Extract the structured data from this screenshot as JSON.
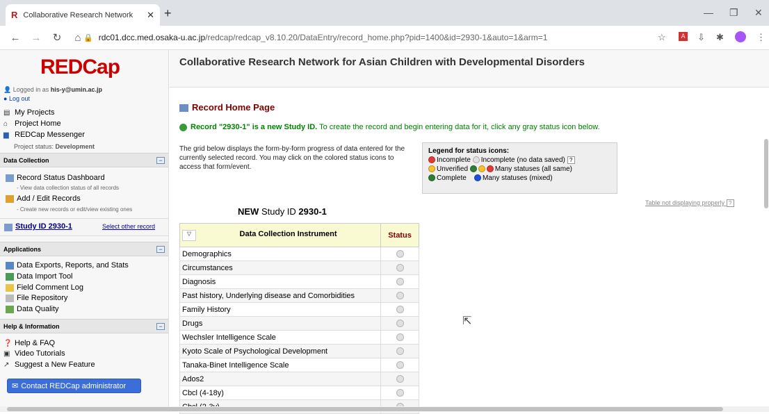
{
  "browser": {
    "tab_title": "Collaborative Research Network",
    "tab_close": "✕",
    "new_tab": "+",
    "url_host": "rdc01.dcc.med.osaka-u.ac.jp",
    "url_path": "/redcap/redcap_v8.10.20/DataEntry/record_home.php?pid=1400&id=2930-1&auto=1&arm=1"
  },
  "sidebar": {
    "logo": "REDCap",
    "logged_in_prefix": "Logged in as ",
    "user": "his-y@umin.ac.jp",
    "logout": "Log out",
    "my_projects": "My Projects",
    "project_home": "Project Home",
    "messenger": "REDCap Messenger",
    "project_status_label": "Project status: ",
    "project_status": "Development",
    "data_collection": {
      "title": "Data Collection",
      "record_status": "Record Status Dashboard",
      "record_status_sub": "- View data collection status of all records",
      "add_edit": "Add / Edit Records",
      "add_edit_sub": "- Create new records or edit/view existing ones",
      "study_id": "Study ID 2930-1",
      "select_other": "Select other record"
    },
    "applications": {
      "title": "Applications",
      "items": [
        "Data Exports, Reports, and Stats",
        "Data Import Tool",
        "Field Comment Log",
        "File Repository",
        "Data Quality"
      ]
    },
    "help": {
      "title": "Help & Information",
      "items": [
        "Help & FAQ",
        "Video Tutorials",
        "Suggest a New Feature"
      ]
    },
    "contact": "Contact REDCap administrator"
  },
  "main": {
    "project_title": "Collaborative Research Network for Asian Children with Developmental Disorders",
    "page_title": "Record Home Page",
    "new_record_bold": "Record \"2930-1\" is a new Study ID.",
    "new_record_rest": " To create the record and begin entering data for it, click any gray status icon below.",
    "grid_desc": "The grid below displays the form-by-form progress of data entered for the currently selected record. You may click on the colored status icons to access that form/event.",
    "legend": {
      "title": "Legend for status icons:",
      "incomplete": "Incomplete",
      "incomplete_nodata": "Incomplete (no data saved)",
      "unverified": "Unverified",
      "many_same": "Many statuses (all same)",
      "complete": "Complete",
      "many_mixed": "Many statuses (mixed)"
    },
    "table_not_display": "Table not displaying properly",
    "new_study_prefix": "NEW",
    "new_study_label": " Study ID ",
    "new_study_id": "2930-1",
    "table": {
      "col_instrument": "Data Collection Instrument",
      "col_status": "Status",
      "rows": [
        "Demographics",
        "Circumstances",
        "Diagnosis",
        "Past history, Underlying disease and Comorbidities",
        "Family History",
        "Drugs",
        "Wechsler Intelligence Scale",
        "Kyoto Scale of Psychological Development",
        "Tanaka-Binet Intelligence Scale",
        "Ados2",
        "Cbcl (4-18y)",
        "Cbcl (2-3y)"
      ]
    }
  },
  "colors": {
    "incomplete": "#e53935",
    "unverified": "#fbc02d",
    "complete": "#2e7d32",
    "mixed": "#1e4fd8"
  }
}
